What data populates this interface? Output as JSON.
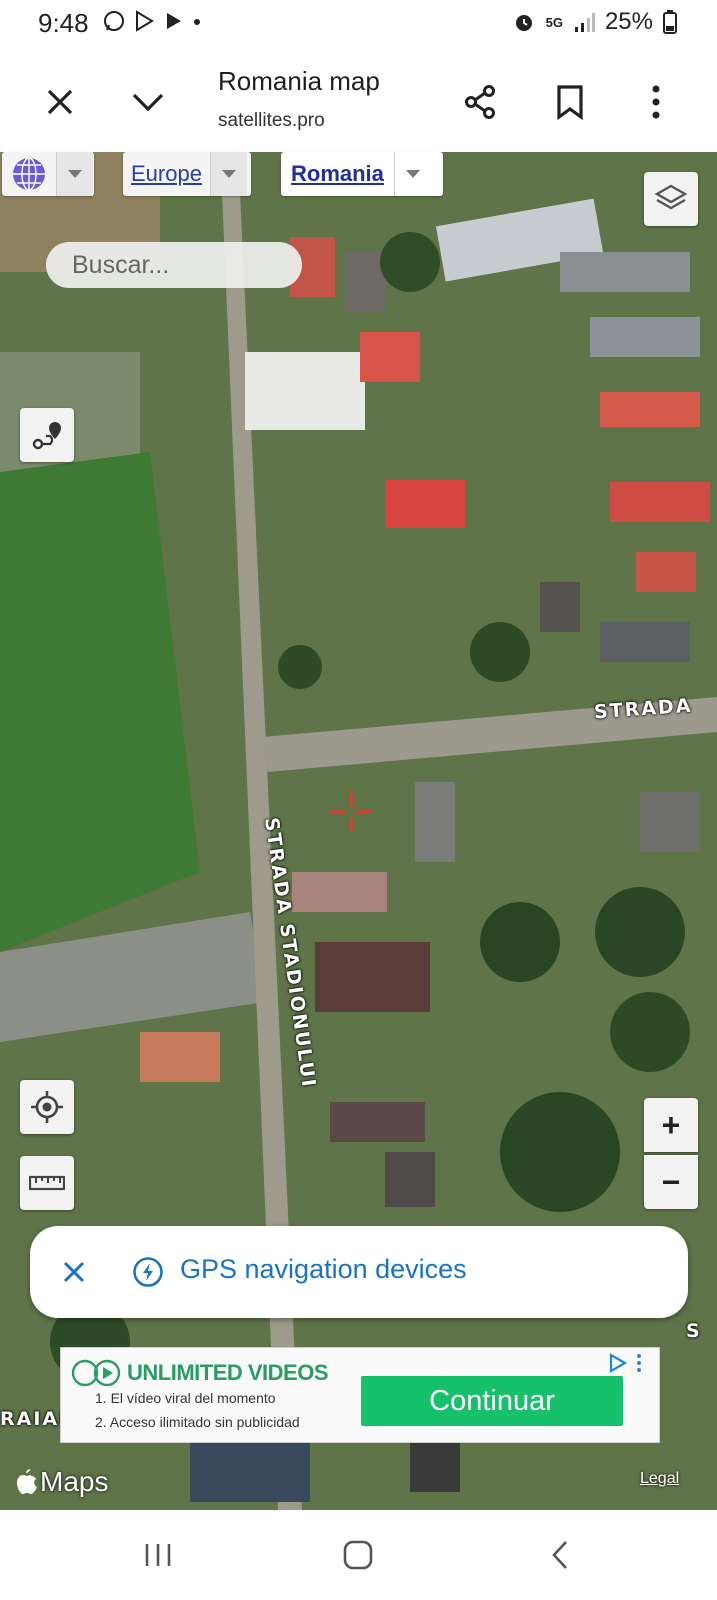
{
  "status_bar": {
    "time": "9:48",
    "network": "5G",
    "battery": "25%"
  },
  "browser": {
    "title": "Romania map",
    "url": "satellites.pro"
  },
  "map": {
    "breadcrumb": {
      "region": "Europe",
      "country": "Romania"
    },
    "search_placeholder": "Buscar...",
    "road_labels": {
      "strada_right": "STRADA",
      "stadionului": "STRADA STADIONULUI",
      "raian": "RAIAN",
      "right_edge_s": "S"
    },
    "zoom_in": "+",
    "zoom_out": "−",
    "attribution_brand": "Maps",
    "legal": "Legal"
  },
  "gps_banner": {
    "text": "GPS navigation devices"
  },
  "ad": {
    "title": "UNLIMITED VIDEOS",
    "line1": "1. El vídeo viral del momento",
    "line2": "2. Acceso ilimitado sin publicidad",
    "cta": "Continuar"
  },
  "colors": {
    "link_blue": "#2a3ea8",
    "gps_blue": "#1a73c8",
    "ad_green": "#17c06a",
    "crosshair_red": "#e53935"
  }
}
